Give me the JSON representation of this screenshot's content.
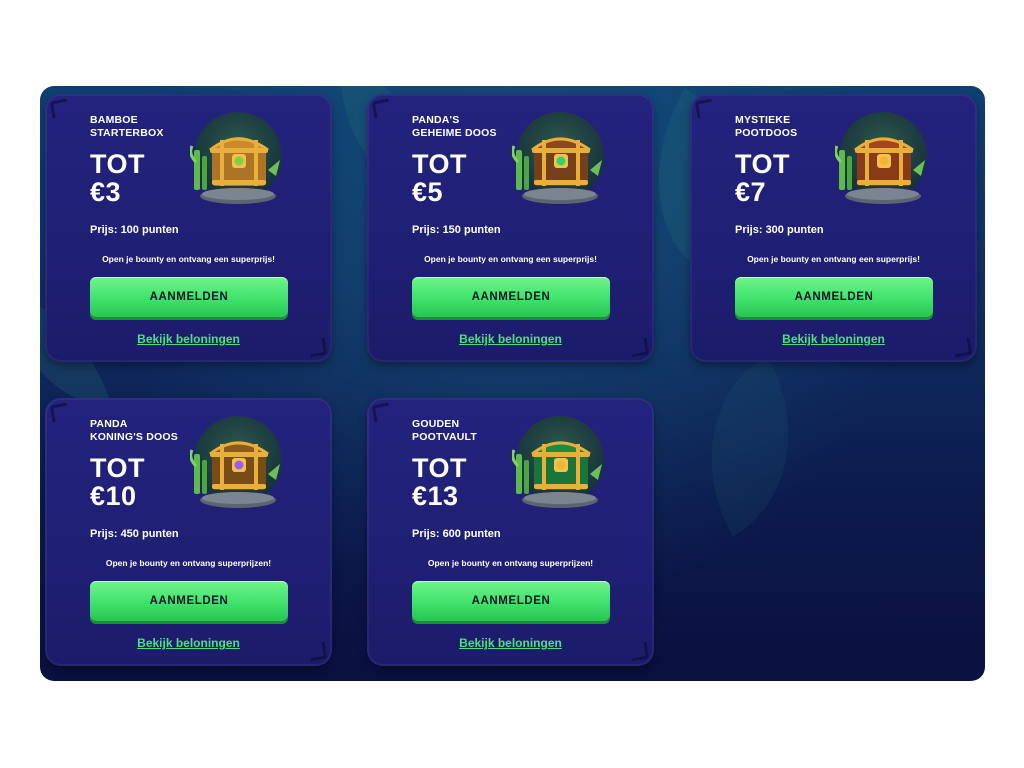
{
  "boxes": [
    {
      "title_line1": "BAMBOE",
      "title_line2": "STARTERBOX",
      "prize_prefix": "TOT",
      "prize_amount": "€3",
      "price": "Prijs: 100 punten",
      "tagline": "Open je bounty en ontvang een superprijs!",
      "button": "AANMELDEN",
      "link": "Bekijk beloningen",
      "chest_icon": "wooden-chest-icon",
      "chest_color": "#c98a2c",
      "gem_color": "#7fd14a"
    },
    {
      "title_line1": "PANDA'S",
      "title_line2": "GEHEIME DOOS",
      "prize_prefix": "TOT",
      "prize_amount": "€5",
      "price": "Prijs: 150 punten",
      "tagline": "Open je bounty en ontvang een superprijs!",
      "button": "AANMELDEN",
      "link": "Bekijk beloningen",
      "chest_icon": "emerald-chest-icon",
      "chest_color": "#8a4a1e",
      "gem_color": "#34d46a"
    },
    {
      "title_line1": "MYSTIEKE",
      "title_line2": "POOTDOOS",
      "prize_prefix": "TOT",
      "prize_amount": "€7",
      "price": "Prijs: 300 punten",
      "tagline": "Open je bounty en ontvang een superprijs!",
      "button": "AANMELDEN",
      "link": "Bekijk beloningen",
      "chest_icon": "mystic-chest-icon",
      "chest_color": "#a4451c",
      "gem_color": "#f2b52f"
    },
    {
      "title_line1": "PANDA",
      "title_line2": "KONING'S DOOS",
      "prize_prefix": "TOT",
      "prize_amount": "€10",
      "price": "Prijs: 450 punten",
      "tagline": "Open je bounty en ontvang superprijzen!",
      "button": "AANMELDEN",
      "link": "Bekijk beloningen",
      "chest_icon": "royal-chest-icon",
      "chest_color": "#8c5a1c",
      "gem_color": "#9b5cf2"
    },
    {
      "title_line1": "GOUDEN",
      "title_line2": "POOTVAULT",
      "prize_prefix": "TOT",
      "prize_amount": "€13",
      "price": "Prijs: 600 punten",
      "tagline": "Open je bounty en ontvang superprijzen!",
      "button": "AANMELDEN",
      "link": "Bekijk beloningen",
      "chest_icon": "jade-chest-icon",
      "chest_color": "#1f8a45",
      "gem_color": "#f0b633"
    }
  ]
}
